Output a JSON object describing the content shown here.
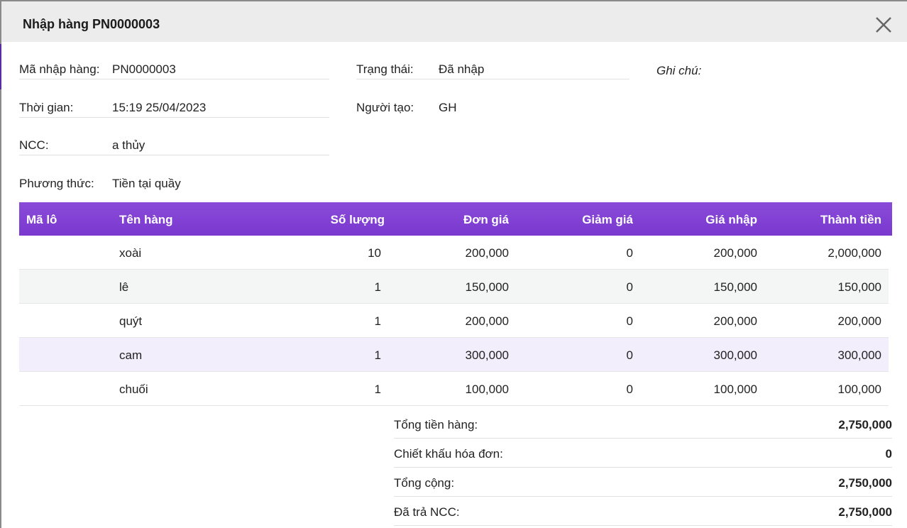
{
  "modal": {
    "title": "Nhập hàng PN0000003"
  },
  "info": {
    "code_label": "Mã nhập hàng:",
    "code_value": "PN0000003",
    "time_label": "Thời gian:",
    "time_value": "15:19 25/04/2023",
    "supplier_label": "NCC:",
    "supplier_value": "a thủy",
    "method_label": "Phương thức:",
    "method_value": "Tiền tại quầy",
    "status_label": "Trạng thái:",
    "status_value": "Đã nhập",
    "creator_label": "Người tạo:",
    "creator_value": "GH",
    "note_label": "Ghi chú:"
  },
  "table": {
    "headers": [
      "Mã lô",
      "Tên hàng",
      "Số lượng",
      "Đơn giá",
      "Giảm giá",
      "Giá nhập",
      "Thành tiền"
    ],
    "rows": [
      {
        "lot": "",
        "name": "xoài",
        "qty": "10",
        "price": "200,000",
        "discount": "0",
        "import_price": "200,000",
        "total": "2,000,000"
      },
      {
        "lot": "",
        "name": "lê",
        "qty": "1",
        "price": "150,000",
        "discount": "0",
        "import_price": "150,000",
        "total": "150,000"
      },
      {
        "lot": "",
        "name": "quýt",
        "qty": "1",
        "price": "200,000",
        "discount": "0",
        "import_price": "200,000",
        "total": "200,000"
      },
      {
        "lot": "",
        "name": "cam",
        "qty": "1",
        "price": "300,000",
        "discount": "0",
        "import_price": "300,000",
        "total": "300,000"
      },
      {
        "lot": "",
        "name": "chuối",
        "qty": "1",
        "price": "100,000",
        "discount": "0",
        "import_price": "100,000",
        "total": "100,000"
      }
    ]
  },
  "totals": {
    "subtotal_label": "Tổng tiền hàng:",
    "subtotal_value": "2,750,000",
    "discount_label": "Chiết khấu hóa đơn:",
    "discount_value": "0",
    "grand_label": "Tổng cộng:",
    "grand_value": "2,750,000",
    "paid_label": "Đã trả NCC:",
    "paid_value": "2,750,000"
  },
  "colors": {
    "header_purple": "#7a38cf",
    "highlight_row": "#f3eefb"
  }
}
